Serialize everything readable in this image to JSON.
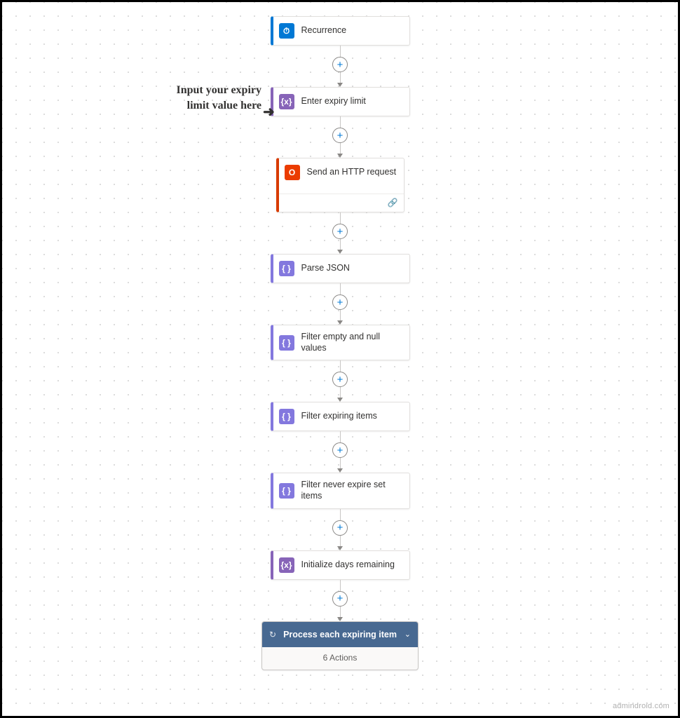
{
  "annotation": "Input your expiry limit value here",
  "steps": [
    {
      "label": "Recurrence",
      "accent": "acc-blue",
      "icon_bg": "ic-blue",
      "icon_name": "clock-icon",
      "glyph": "⏱"
    },
    {
      "label": "Enter expiry limit",
      "accent": "acc-purple",
      "icon_bg": "ic-purple",
      "icon_name": "variable-icon",
      "glyph": "{x}"
    },
    {
      "label": "Send an HTTP request",
      "accent": "acc-orange",
      "icon_bg": "ic-orange",
      "icon_name": "office-icon",
      "glyph": "O",
      "has_link_footer": true
    },
    {
      "label": "Parse JSON",
      "accent": "acc-violet",
      "icon_bg": "ic-violet",
      "icon_name": "braces-icon",
      "glyph": "{ }"
    },
    {
      "label": "Filter empty and null values",
      "accent": "acc-violet",
      "icon_bg": "ic-violet",
      "icon_name": "braces-icon",
      "glyph": "{ }"
    },
    {
      "label": "Filter expiring items",
      "accent": "acc-violet",
      "icon_bg": "ic-violet",
      "icon_name": "braces-icon",
      "glyph": "{ }"
    },
    {
      "label": "Filter never expire set items",
      "accent": "acc-violet",
      "icon_bg": "ic-violet",
      "icon_name": "braces-icon",
      "glyph": "{ }"
    },
    {
      "label": "Initialize days remaining",
      "accent": "acc-purple",
      "icon_bg": "ic-purple",
      "icon_name": "variable-icon",
      "glyph": "{x}"
    }
  ],
  "foreach": {
    "label": "Process each expiring item",
    "body": "6 Actions"
  },
  "watermark": "admindroid.com"
}
